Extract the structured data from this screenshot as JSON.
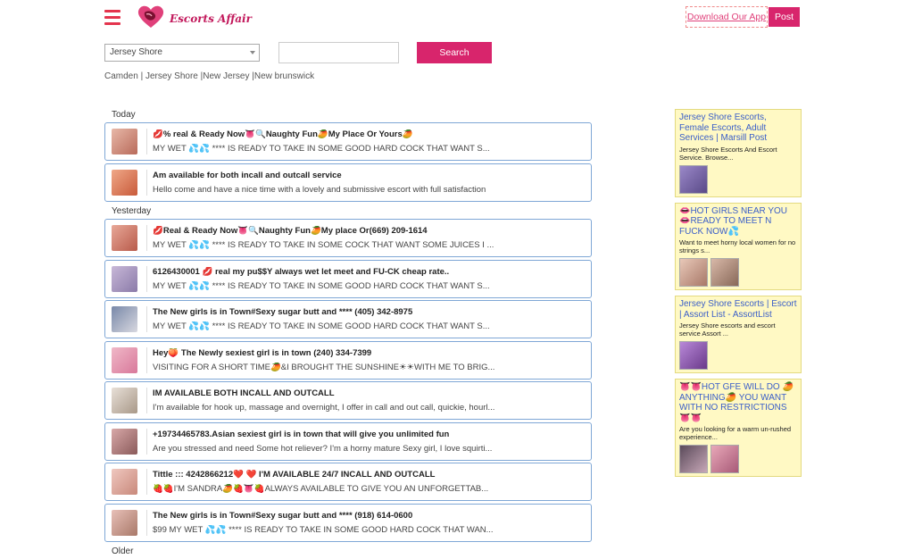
{
  "header": {
    "brand_name": "Escorts Affair",
    "download_label": "Download Our App",
    "post_label": "Post"
  },
  "search": {
    "city_selected": "Jersey Shore",
    "input_value": "",
    "button_label": "Search"
  },
  "breadcrumb": [
    "Camden | ",
    "Jersey Shore |",
    "New Jersey |",
    "New brunswick"
  ],
  "sections": {
    "today": "Today",
    "yesterday": "Yesterday",
    "older": "Older"
  },
  "listings": [
    {
      "title": "💋% real & Ready Now👅🔍Naughty Fun🥭My Place Or Yours🥭",
      "desc": "MY WET 💦💦 **** IS READY TO TAKE IN SOME GOOD HARD COCK THAT WANT S..."
    },
    {
      "title": "Am available for both incall and outcall service",
      "desc": "Hello come and have a nice time with a lovely and submissive escort with full satisfaction"
    },
    {
      "title": "💋Real & Ready Now👅🔍Naughty Fun🥭My place Or(669) 209-1614",
      "desc": "MY WET 💦💦 **** IS READY TO TAKE IN SOME COCK THAT WANT SOME JUICES I ..."
    },
    {
      "title": "6126430001 💋 real my pu$$Y always wet let meet and FU-CK cheap rate..",
      "desc": "MY WET 💦💦 **** IS READY TO TAKE IN SOME GOOD HARD COCK THAT WANT S..."
    },
    {
      "title": "The New girls is in Town#Sexy sugar butt and **** (405) 342-8975",
      "desc": "MY WET 💦💦 **** IS READY TO TAKE IN SOME GOOD HARD COCK THAT WANT S..."
    },
    {
      "title": "Hey🍑 The Newly sexiest girl is in town (240) 334-7399",
      "desc": "VISITING FOR A SHORT TIME🥭&I BROUGHT THE SUNSHINE☀☀WITH ME TO BRIG..."
    },
    {
      "title": "IM AVAILABLE BOTH INCALL AND OUTCALL",
      "desc": "I'm available for hook up, massage and overnight, I offer in call and out call, quickie, hourl..."
    },
    {
      "title": "+19734465783.Asian sexiest girl is in town that will give you unlimited fun",
      "desc": "Are you stressed and need Some hot reliever? I'm a horny mature Sexy girl, I love squirti..."
    },
    {
      "title": "Tittle ::: 4242866212❤️ ❤️ I'M AVAILABLE 24/7 INCALL AND OUTCALL",
      "desc": "🍓🍓I'M SANDRA🥭🍓👅🍓ALWAYS AVAILABLE TO GIVE YOU AN UNFORGETTAB..."
    },
    {
      "title": "The New girls is in Town#Sexy sugar butt and **** (918) 614-0600",
      "desc": "$99 MY WET 💦💦 **** IS READY TO TAKE IN SOME GOOD HARD COCK THAT WAN..."
    }
  ],
  "ads": [
    {
      "title": "Jersey Shore Escorts, Female Escorts, Adult Services | Marsill Post",
      "desc": "Jersey Shore Escorts And Escort Service. Browse..."
    },
    {
      "title": "👄HOT GIRLS NEAR YOU 👄READY TO MEET N FUCK NOW💦",
      "desc": "Want to meet horny local women for no strings s..."
    },
    {
      "title": "Jersey Shore Escorts | Escort | Assort List - AssortList",
      "desc": "Jersey Shore escorts and escort service Assort ..."
    },
    {
      "title": "👅👅HOT GFE WILL DO 🥭ANYTHING🥭 YOU WANT WITH NO RESTRICTIONS👅👅",
      "desc": "Are you looking for a warm un-rushed experience..."
    }
  ],
  "colors": {
    "brand": "#d8256c",
    "menu": "#e4344d",
    "card_border": "#7fa7d6",
    "ad_bg": "#fff9c4",
    "ad_link": "#3a5ec8"
  }
}
